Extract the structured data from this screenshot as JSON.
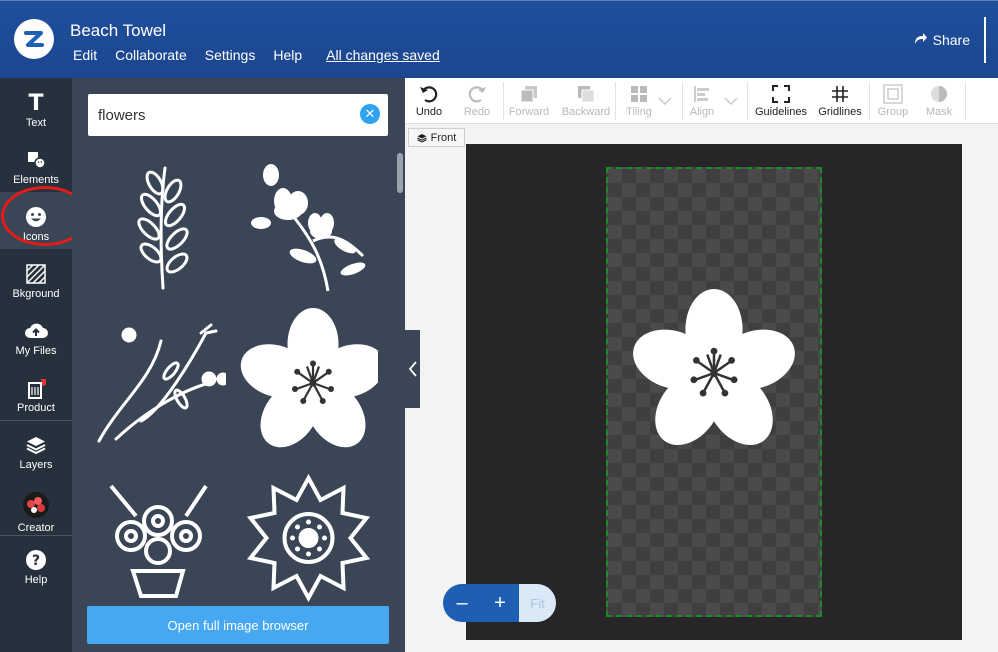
{
  "header": {
    "title": "Beach Towel",
    "menu": [
      "Edit",
      "Collaborate",
      "Settings",
      "Help"
    ],
    "saved_status": "All changes saved",
    "share_label": "Share"
  },
  "rail": {
    "items": [
      {
        "label": "Text",
        "icon": "text-icon"
      },
      {
        "label": "Elements",
        "icon": "elements-icon"
      },
      {
        "label": "Icons",
        "icon": "smiley-icon"
      },
      {
        "label": "Bkground",
        "icon": "background-icon"
      },
      {
        "label": "My Files",
        "icon": "cloud-upload-icon"
      },
      {
        "label": "Product",
        "icon": "product-icon"
      },
      {
        "label": "Layers",
        "icon": "layers-icon"
      },
      {
        "label": "Creator",
        "icon": "creator-avatar"
      },
      {
        "label": "Help",
        "icon": "help-icon"
      }
    ],
    "active": "Icons"
  },
  "panel": {
    "search_value": "flowers",
    "results": [
      "leaf-sprig",
      "magnolia-branch",
      "wildflower-stems",
      "five-petal-flower",
      "flower-pot",
      "sunflower"
    ],
    "browse_button": "Open full image browser"
  },
  "toolbar": {
    "tools": [
      {
        "label": "Undo",
        "enabled": true
      },
      {
        "label": "Redo",
        "enabled": false
      },
      {
        "label": "Forward",
        "enabled": false
      },
      {
        "label": "Backward",
        "enabled": false
      },
      {
        "label": "Tiling",
        "enabled": false
      },
      {
        "label": "Align",
        "enabled": false
      },
      {
        "label": "Guidelines",
        "enabled": true
      },
      {
        "label": "Gridlines",
        "enabled": true
      },
      {
        "label": "Group",
        "enabled": false
      },
      {
        "label": "Mask",
        "enabled": false
      }
    ]
  },
  "canvas": {
    "side_tab": "Front",
    "placed_element": "five-petal-flower"
  },
  "zoom": {
    "minus": "–",
    "plus": "+",
    "fit": "Fit"
  },
  "colors": {
    "header": "#1f4f9c",
    "rail": "#27313e",
    "panel": "#3a4655",
    "accent": "#46a8f3",
    "safe_area": "#1f8a2a",
    "highlight_circle": "#e31b1b"
  }
}
